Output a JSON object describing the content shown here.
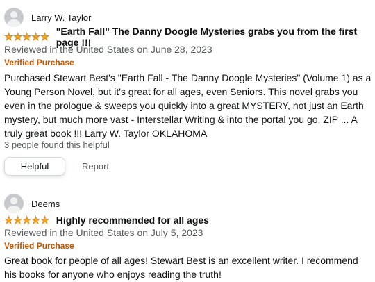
{
  "reviews": [
    {
      "reviewer_name": "Larry W. Taylor",
      "rating": 5,
      "title": "\"Earth Fall\" The Danny Doogle Mysteries grabs you from the first page !!!",
      "date_line": "Reviewed in the United States on June 28, 2023",
      "verified_label": "Verified Purchase",
      "body": "Purchased Stewart Best's \"Earth Fall - The Danny Doogle Mysteries\" (Volume 1) as a Young Person Novel, but it's great for all ages, even Seniors. This novel grabs you even in the prologue & sweeps you quickly into a great MYSTERY, not just an Earth mystery, but much more vast - Interstellar Writing & into the portal you go, ZIP ... A truly great book !!! Larry W. Taylor OKLAHOMA",
      "helpful_count": "3 people found this helpful",
      "helpful_button": "Helpful",
      "report_link": "Report"
    },
    {
      "reviewer_name": "Deems",
      "rating": 5,
      "title": "Highly recommended for all ages",
      "date_line": "Reviewed in the United States on July 5, 2023",
      "verified_label": "Verified Purchase",
      "body": "Great book for people of all ages! Stewart Best is an excellent writer. I recommend his books for anyone who enjoys reading the truth!"
    }
  ],
  "colors": {
    "star": "#f7a31a",
    "verified": "#c45500",
    "secondary_text": "#565959"
  },
  "icons": {
    "avatar": "default-profile-avatar-icon",
    "star": "star-icon"
  }
}
